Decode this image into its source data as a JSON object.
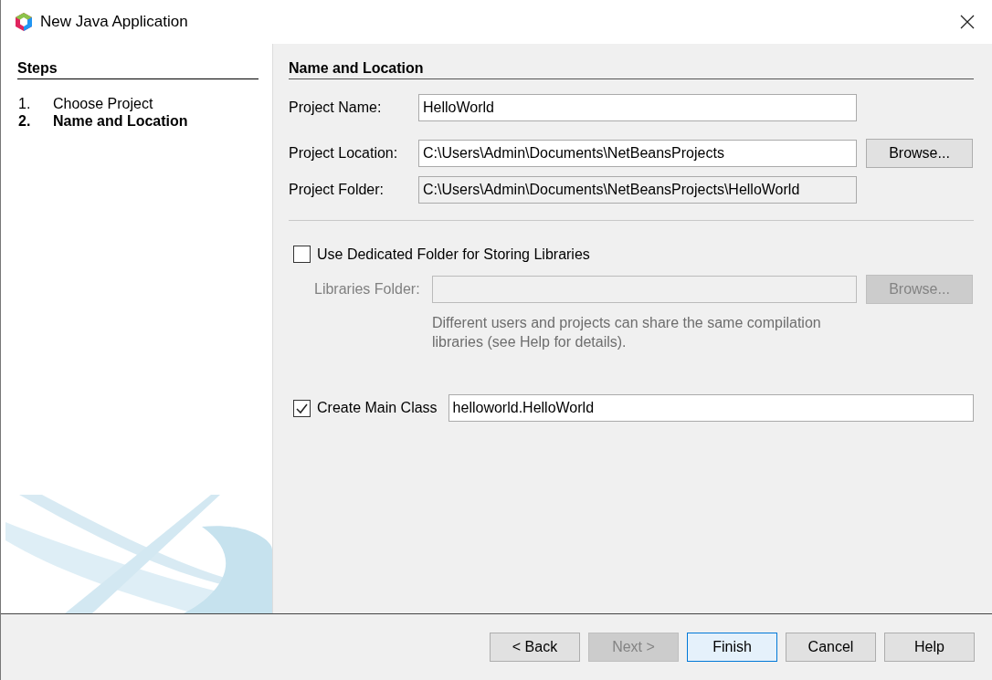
{
  "window": {
    "title": "New Java Application"
  },
  "steps": {
    "heading": "Steps",
    "items": [
      {
        "number": "1.",
        "label": "Choose Project",
        "selected": false
      },
      {
        "number": "2.",
        "label": "Name and Location",
        "selected": true
      }
    ]
  },
  "panel": {
    "heading": "Name and Location",
    "fields": [
      {
        "label": "Project Name:",
        "value": "HelloWorld",
        "readonly": false
      },
      {
        "label": "Project Location:",
        "value": "C:\\Users\\Admin\\Documents\\NetBeansProjects",
        "readonly": false,
        "button": {
          "label": "Browse...",
          "disabled": false
        }
      },
      {
        "label": "Project Folder:",
        "value": "C:\\Users\\Admin\\Documents\\NetBeansProjects\\HelloWorld",
        "readonly": true
      }
    ],
    "dedicated_folder": {
      "label": "Use Dedicated Folder for Storing Libraries",
      "checked": false
    },
    "libraries": {
      "label": "Libraries Folder:",
      "disabled": true,
      "button": {
        "label": "Browse...",
        "disabled": true
      },
      "hint": "Different users and projects can share the same compilation libraries (see Help for details)."
    },
    "main_class": {
      "label": "Create Main Class",
      "checked": true,
      "value": "helloworld.HelloWorld"
    }
  },
  "buttons": [
    {
      "label": "< Back",
      "disabled": false,
      "default": false
    },
    {
      "label": "Next >",
      "disabled": true,
      "default": false
    },
    {
      "label": "Finish",
      "disabled": false,
      "default": true
    },
    {
      "label": "Cancel",
      "disabled": false,
      "default": false
    },
    {
      "label": "Help",
      "disabled": false,
      "default": false
    }
  ]
}
